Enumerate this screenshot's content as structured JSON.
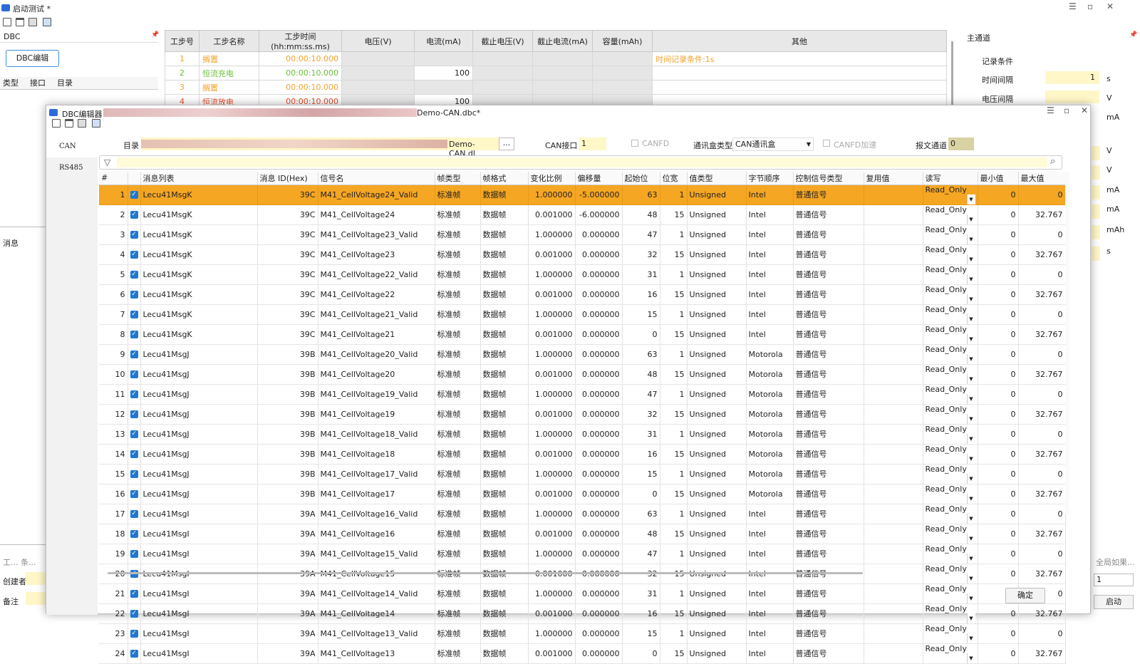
{
  "window": {
    "title": "启动测试 *",
    "min": "☰",
    "max": "▫",
    "close": "✕"
  },
  "left_panel": {
    "dbc_label": "DBC",
    "dbc_edit_button": "DBC编辑",
    "columns": [
      "类型",
      "接口",
      "目录"
    ],
    "message_label": "消息",
    "bottom_tabs": "工...  条...  ",
    "creator_label": "创建者",
    "note_label": "备注"
  },
  "step_table": {
    "headers": [
      "工步号",
      "工步名称",
      "工步时间(hh:mm:ss.ms)",
      "电压(V)",
      "电流(mA)",
      "截止电压(V)",
      "截止电流(mA)",
      "容量(mAh)",
      "其他"
    ],
    "rows": [
      {
        "no": "1",
        "name": "搁置",
        "time": "00:00:10.000",
        "voltage": "",
        "current": "",
        "cut_v": "",
        "cut_i": "",
        "cap": "",
        "other": "时间记录条件:1s",
        "color": "orange"
      },
      {
        "no": "2",
        "name": "恒流充电",
        "time": "00:00:10.000",
        "voltage": "",
        "current": "100",
        "cut_v": "",
        "cut_i": "",
        "cap": "",
        "other": "",
        "color": "green"
      },
      {
        "no": "3",
        "name": "搁置",
        "time": "00:00:10.000",
        "voltage": "",
        "current": "",
        "cut_v": "",
        "cut_i": "",
        "cap": "",
        "other": "",
        "color": "orange"
      },
      {
        "no": "4",
        "name": "恒流放电",
        "time": "00:00:10.000",
        "voltage": "",
        "current": "100",
        "cut_v": "",
        "cut_i": "",
        "cap": "",
        "other": "",
        "color": "red"
      }
    ]
  },
  "right_panel": {
    "title": "主通道",
    "record_condition": "记录条件",
    "time_interval_label": "时间间隔",
    "time_interval_value": "1",
    "time_unit": "s",
    "voltage_interval_label": "电压间隔",
    "voltage_unit": "V",
    "units_below": [
      "mA",
      "V",
      "V",
      "mA",
      "mA",
      "mAh",
      "s"
    ],
    "global_if": "全局如果...",
    "spin_value": "1",
    "start_button": "启动"
  },
  "dialog": {
    "title": "DBC编辑器",
    "title_suffix": "Demo-CAN.dbc*",
    "side_tabs": [
      "CAN",
      "RS485"
    ],
    "dir_label": "目录",
    "dir_value": "Demo-CAN.dl",
    "browse": "...",
    "can_port_label": "CAN接口",
    "can_port_value": "1",
    "canfd_label": "CANFD",
    "box_type_label": "通讯盒类型",
    "box_type_value": "CAN通讯盒",
    "canfd_accel_label": "CANFD加速",
    "report_channel_label": "报文通道",
    "report_channel_value": "0",
    "ok_button": "确定",
    "columns": [
      "#",
      "",
      "消息列表",
      "消息 ID(Hex)",
      "信号名",
      "帧类型",
      "帧格式",
      "变化比例",
      "偏移量",
      "起始位",
      "位宽",
      "值类型",
      "字节顺序",
      "控制信号类型",
      "复用值",
      "读写",
      "最小值",
      "最大值"
    ],
    "rows": [
      [
        "1",
        "Lecu41MsgK",
        "39C",
        "M41_CellVoltage24_Valid",
        "标准帧",
        "数据帧",
        "1.000000",
        "-5.000000",
        "63",
        "1",
        "Unsigned",
        "Intel",
        "普通信号",
        "",
        "Read_Only",
        "0",
        "0"
      ],
      [
        "2",
        "Lecu41MsgK",
        "39C",
        "M41_CellVoltage24",
        "标准帧",
        "数据帧",
        "0.001000",
        "-6.000000",
        "48",
        "15",
        "Unsigned",
        "Intel",
        "普通信号",
        "",
        "Read_Only",
        "0",
        "32.767"
      ],
      [
        "3",
        "Lecu41MsgK",
        "39C",
        "M41_CellVoltage23_Valid",
        "标准帧",
        "数据帧",
        "1.000000",
        "0.000000",
        "47",
        "1",
        "Unsigned",
        "Intel",
        "普通信号",
        "",
        "Read_Only",
        "0",
        "0"
      ],
      [
        "4",
        "Lecu41MsgK",
        "39C",
        "M41_CellVoltage23",
        "标准帧",
        "数据帧",
        "0.001000",
        "0.000000",
        "32",
        "15",
        "Unsigned",
        "Intel",
        "普通信号",
        "",
        "Read_Only",
        "0",
        "32.767"
      ],
      [
        "5",
        "Lecu41MsgK",
        "39C",
        "M41_CellVoltage22_Valid",
        "标准帧",
        "数据帧",
        "1.000000",
        "0.000000",
        "31",
        "1",
        "Unsigned",
        "Intel",
        "普通信号",
        "",
        "Read_Only",
        "0",
        "0"
      ],
      [
        "6",
        "Lecu41MsgK",
        "39C",
        "M41_CellVoltage22",
        "标准帧",
        "数据帧",
        "0.001000",
        "0.000000",
        "16",
        "15",
        "Unsigned",
        "Intel",
        "普通信号",
        "",
        "Read_Only",
        "0",
        "32.767"
      ],
      [
        "7",
        "Lecu41MsgK",
        "39C",
        "M41_CellVoltage21_Valid",
        "标准帧",
        "数据帧",
        "1.000000",
        "0.000000",
        "15",
        "1",
        "Unsigned",
        "Intel",
        "普通信号",
        "",
        "Read_Only",
        "0",
        "0"
      ],
      [
        "8",
        "Lecu41MsgK",
        "39C",
        "M41_CellVoltage21",
        "标准帧",
        "数据帧",
        "0.001000",
        "0.000000",
        "0",
        "15",
        "Unsigned",
        "Intel",
        "普通信号",
        "",
        "Read_Only",
        "0",
        "32.767"
      ],
      [
        "9",
        "Lecu41MsgJ",
        "39B",
        "M41_CellVoltage20_Valid",
        "标准帧",
        "数据帧",
        "1.000000",
        "0.000000",
        "63",
        "1",
        "Unsigned",
        "Motorola",
        "普通信号",
        "",
        "Read_Only",
        "0",
        "0"
      ],
      [
        "10",
        "Lecu41MsgJ",
        "39B",
        "M41_CellVoltage20",
        "标准帧",
        "数据帧",
        "0.001000",
        "0.000000",
        "48",
        "15",
        "Unsigned",
        "Motorola",
        "普通信号",
        "",
        "Read_Only",
        "0",
        "32.767"
      ],
      [
        "11",
        "Lecu41MsgJ",
        "39B",
        "M41_CellVoltage19_Valid",
        "标准帧",
        "数据帧",
        "1.000000",
        "0.000000",
        "47",
        "1",
        "Unsigned",
        "Motorola",
        "普通信号",
        "",
        "Read_Only",
        "0",
        "0"
      ],
      [
        "12",
        "Lecu41MsgJ",
        "39B",
        "M41_CellVoltage19",
        "标准帧",
        "数据帧",
        "0.001000",
        "0.000000",
        "32",
        "15",
        "Unsigned",
        "Motorola",
        "普通信号",
        "",
        "Read_Only",
        "0",
        "32.767"
      ],
      [
        "13",
        "Lecu41MsgJ",
        "39B",
        "M41_CellVoltage18_Valid",
        "标准帧",
        "数据帧",
        "1.000000",
        "0.000000",
        "31",
        "1",
        "Unsigned",
        "Motorola",
        "普通信号",
        "",
        "Read_Only",
        "0",
        "0"
      ],
      [
        "14",
        "Lecu41MsgJ",
        "39B",
        "M41_CellVoltage18",
        "标准帧",
        "数据帧",
        "0.001000",
        "0.000000",
        "16",
        "15",
        "Unsigned",
        "Motorola",
        "普通信号",
        "",
        "Read_Only",
        "0",
        "32.767"
      ],
      [
        "15",
        "Lecu41MsgJ",
        "39B",
        "M41_CellVoltage17_Valid",
        "标准帧",
        "数据帧",
        "1.000000",
        "0.000000",
        "15",
        "1",
        "Unsigned",
        "Motorola",
        "普通信号",
        "",
        "Read_Only",
        "0",
        "0"
      ],
      [
        "16",
        "Lecu41MsgJ",
        "39B",
        "M41_CellVoltage17",
        "标准帧",
        "数据帧",
        "0.001000",
        "0.000000",
        "0",
        "15",
        "Unsigned",
        "Motorola",
        "普通信号",
        "",
        "Read_Only",
        "0",
        "32.767"
      ],
      [
        "17",
        "Lecu41MsgI",
        "39A",
        "M41_CellVoltage16_Valid",
        "标准帧",
        "数据帧",
        "1.000000",
        "0.000000",
        "63",
        "1",
        "Unsigned",
        "Intel",
        "普通信号",
        "",
        "Read_Only",
        "0",
        "0"
      ],
      [
        "18",
        "Lecu41MsgI",
        "39A",
        "M41_CellVoltage16",
        "标准帧",
        "数据帧",
        "0.001000",
        "0.000000",
        "48",
        "15",
        "Unsigned",
        "Intel",
        "普通信号",
        "",
        "Read_Only",
        "0",
        "32.767"
      ],
      [
        "19",
        "Lecu41MsgI",
        "39A",
        "M41_CellVoltage15_Valid",
        "标准帧",
        "数据帧",
        "1.000000",
        "0.000000",
        "47",
        "1",
        "Unsigned",
        "Intel",
        "普通信号",
        "",
        "Read_Only",
        "0",
        "0"
      ],
      [
        "20",
        "Lecu41MsgI",
        "39A",
        "M41_CellVoltage15",
        "标准帧",
        "数据帧",
        "0.001000",
        "0.000000",
        "32",
        "15",
        "Unsigned",
        "Intel",
        "普通信号",
        "",
        "Read_Only",
        "0",
        "32.767"
      ],
      [
        "21",
        "Lecu41MsgI",
        "39A",
        "M41_CellVoltage14_Valid",
        "标准帧",
        "数据帧",
        "1.000000",
        "0.000000",
        "31",
        "1",
        "Unsigned",
        "Intel",
        "普通信号",
        "",
        "Read_Only",
        "0",
        "0"
      ],
      [
        "22",
        "Lecu41MsgI",
        "39A",
        "M41_CellVoltage14",
        "标准帧",
        "数据帧",
        "0.001000",
        "0.000000",
        "16",
        "15",
        "Unsigned",
        "Intel",
        "普通信号",
        "",
        "Read_Only",
        "0",
        "32.767"
      ],
      [
        "23",
        "Lecu41MsgI",
        "39A",
        "M41_CellVoltage13_Valid",
        "标准帧",
        "数据帧",
        "1.000000",
        "0.000000",
        "15",
        "1",
        "Unsigned",
        "Intel",
        "普通信号",
        "",
        "Read_Only",
        "0",
        "0"
      ],
      [
        "24",
        "Lecu41MsgI",
        "39A",
        "M41_CellVoltage13",
        "标准帧",
        "数据帧",
        "0.001000",
        "0.000000",
        "0",
        "15",
        "Unsigned",
        "Intel",
        "普通信号",
        "",
        "Read_Only",
        "0",
        "32.767"
      ]
    ]
  },
  "colors": {
    "accent": "#1f78d1",
    "selected_row": "#f5a623",
    "input_yellow": "#fff7c7"
  }
}
